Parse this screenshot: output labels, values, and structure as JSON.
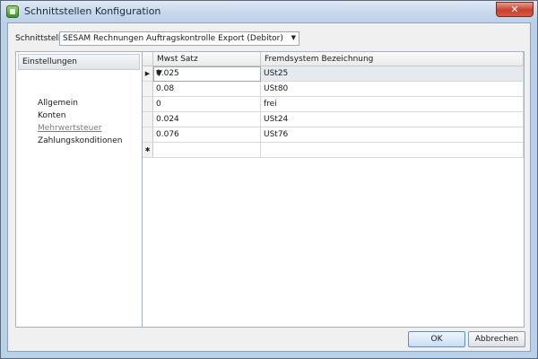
{
  "window": {
    "title": "Schnittstellen Konfiguration",
    "close_glyph": "✕"
  },
  "interface_select": {
    "label": "Schnittstelle",
    "value": "SESAM Rechnungen Auftragskontrolle Export (Debitor)",
    "arrow": "▼"
  },
  "sidebar": {
    "header": "Einstellungen",
    "items": [
      {
        "label": "Allgemein",
        "active": false
      },
      {
        "label": "Konten",
        "active": false
      },
      {
        "label": "Mehrwertsteuer",
        "active": true
      },
      {
        "label": "Zahlungskonditionen",
        "active": false
      }
    ]
  },
  "grid": {
    "columns": [
      "Mwst Satz",
      "Fremdsystem Bezeichnung"
    ],
    "rows": [
      {
        "indicator": "▶",
        "mwst": "0.025",
        "bezeichnung": "USt25",
        "selected": true,
        "dropdown": "▼"
      },
      {
        "indicator": "",
        "mwst": "0.08",
        "bezeichnung": "USt80"
      },
      {
        "indicator": "",
        "mwst": "0",
        "bezeichnung": "frei"
      },
      {
        "indicator": "",
        "mwst": "0.024",
        "bezeichnung": "USt24"
      },
      {
        "indicator": "",
        "mwst": "0.076",
        "bezeichnung": "USt76"
      },
      {
        "indicator": "✱",
        "mwst": "",
        "bezeichnung": ""
      }
    ]
  },
  "buttons": {
    "ok": "OK",
    "cancel": "Abbrechen"
  },
  "colors": {
    "title_bar": "#c7d8ec",
    "close_button": "#c7412d",
    "ok_button_border": "#5d8fc7"
  }
}
